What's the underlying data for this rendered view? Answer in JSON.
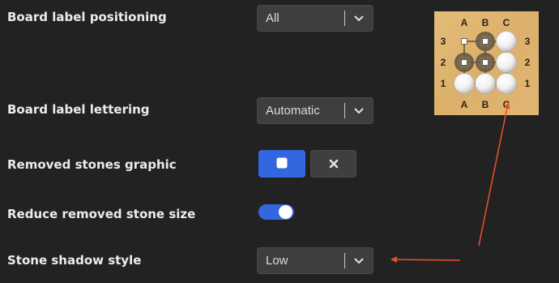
{
  "settings": {
    "label_positioning": {
      "label": "Board label positioning",
      "value": "All"
    },
    "label_lettering": {
      "label": "Board label lettering",
      "value": "Automatic"
    },
    "removed_graphic": {
      "label": "Removed stones graphic",
      "options": [
        "square",
        "cross"
      ],
      "selected": "square"
    },
    "reduce_size": {
      "label": "Reduce removed stone size",
      "enabled": true
    },
    "shadow_style": {
      "label": "Stone shadow style",
      "value": "Low"
    }
  },
  "board_preview": {
    "columns": [
      "A",
      "B",
      "C"
    ],
    "rows": [
      "3",
      "2",
      "1"
    ]
  },
  "colors": {
    "background": "#222223",
    "accent": "#3267e0",
    "board": "#dfb770",
    "annotation_arrow": "#e0502a"
  }
}
